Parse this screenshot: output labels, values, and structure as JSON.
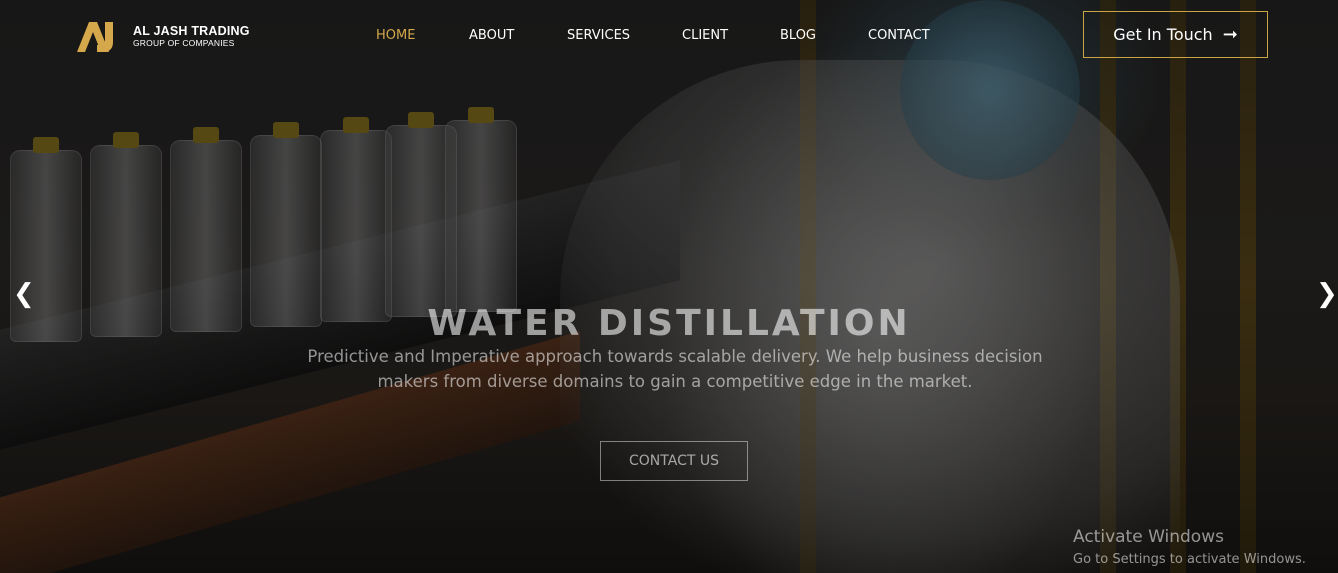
{
  "brand": {
    "name": "AL JASH TRADING",
    "tagline": "GROUP OF COMPANIES",
    "logo_mark": "AJ",
    "accent_color": "#d4a84b"
  },
  "nav": {
    "items": [
      {
        "label": "HOME",
        "active": true
      },
      {
        "label": "ABOUT",
        "active": false
      },
      {
        "label": "SERVICES",
        "active": false
      },
      {
        "label": "CLIENT",
        "active": false
      },
      {
        "label": "BLOG",
        "active": false
      },
      {
        "label": "CONTACT",
        "active": false
      }
    ]
  },
  "header_cta": {
    "label": "Get In Touch",
    "icon": "arrow-right-icon"
  },
  "slider": {
    "prev_icon": "chevron-left-icon",
    "next_icon": "chevron-right-icon"
  },
  "hero": {
    "title": "WATER DISTILLATION",
    "description": "Predictive and Imperative approach towards scalable delivery. We help business decision makers from diverse domains to gain a competitive edge in the market.",
    "cta_label": "CONTACT US"
  },
  "os_watermark": {
    "title": "Activate Windows",
    "subtitle": "Go to Settings to activate Windows."
  }
}
